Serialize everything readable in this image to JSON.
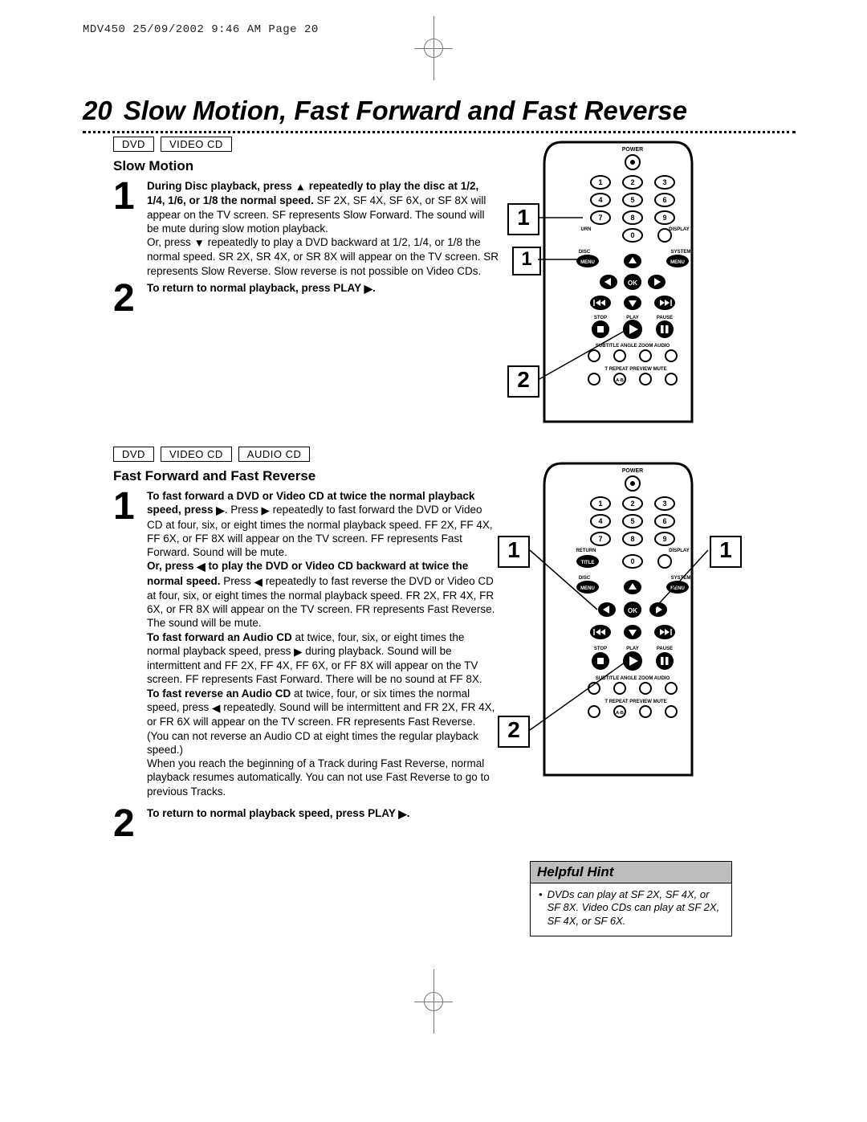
{
  "running_head": "MDV450  25/09/2002  9:46 AM  Page 20",
  "page_number": "20",
  "page_title": "Slow Motion, Fast Forward and Fast Reverse",
  "section_slow": {
    "tags": [
      "DVD",
      "VIDEO CD"
    ],
    "heading": "Slow Motion",
    "step1_bold_a": "During Disc playback, press ",
    "step1_bold_b": " repeatedly to play the disc at 1/2, 1/4, 1/6, or 1/8 the normal speed.",
    "step1_rest": " SF 2X, SF 4X, SF 6X, or SF 8X will appear on the TV screen. SF represents Slow Forward. The sound will be mute during slow motion playback.",
    "step1_or": "Or, press ",
    "step1_or_rest": " repeatedly to play a DVD backward at 1/2, 1/4, or 1/8 the normal speed. SR 2X, SR 4X, or SR 8X will appear on the TV screen. SR represents Slow Reverse. Slow reverse is not possible on Video CDs.",
    "step2": "To return to normal playback, press PLAY "
  },
  "section_fast": {
    "tags": [
      "DVD",
      "VIDEO CD",
      "AUDIO CD"
    ],
    "heading": "Fast Forward and Fast Reverse",
    "p1_bold": "To fast forward a DVD or Video CD at twice the normal playback speed, press ",
    "p1_rest": ". Press ",
    "p1_tail": " repeatedly to fast forward the DVD or Video CD at four, six, or eight times the normal playback speed. FF 2X, FF 4X, FF 6X, or FF 8X will appear on the TV screen. FF represents Fast Forward. Sound will be mute.",
    "p2_bold": "Or, press ",
    "p2_bold2": " to play the DVD or Video CD backward at twice the normal speed.",
    "p2_rest": " Press ",
    "p2_tail": " repeatedly to fast reverse the DVD or Video CD at four, six, or eight times the normal playback speed. FR 2X, FR 4X, FR 6X, or FR 8X will appear on the TV screen. FR represents Fast Reverse. The sound will be mute.",
    "p3_bold": "To fast forward an Audio CD",
    "p3_rest": " at twice, four, six, or eight times the normal playback speed, press ",
    "p3_tail": " during playback. Sound will be intermittent and FF 2X, FF 4X, FF 6X, or FF 8X will appear on the TV screen. FF represents Fast Forward. There will be no sound at FF 8X.",
    "p4_bold": "To fast reverse an Audio CD",
    "p4_rest": " at twice, four, or six times the normal speed, press ",
    "p4_tail": " repeatedly. Sound will be intermittent and FR 2X, FR 4X, or FR 6X will appear on the TV screen. FR represents Fast Reverse. (You can not reverse an Audio CD at eight times the regular playback speed.)",
    "p5": "When you reach the beginning of a Track during Fast Reverse, normal playback resumes automatically. You can not use Fast Reverse to go to previous Tracks.",
    "step2": "To return to normal playback speed, press PLAY "
  },
  "hint": {
    "title": "Helpful Hint",
    "body": "DVDs can play at SF 2X, SF 4X, or SF 8X. Video CDs can play at SF 2X, SF 4X, or SF 6X."
  },
  "remote": {
    "power": "POWER",
    "return": "RETURN",
    "display": "DISPLAY",
    "title": "TITLE",
    "disc_menu": "DISC MENU",
    "system_menu": "SYSTEM MENU",
    "ok": "OK",
    "stop": "STOP",
    "play": "PLAY",
    "pause": "PAUSE",
    "row_labels": "SUBTITLE  ANGLE  ZOOM  AUDIO",
    "row_labels2": "REPEAT  PREVIEW  MUTE",
    "ab": "A-B"
  },
  "callouts": {
    "one": "1",
    "two": "2"
  }
}
